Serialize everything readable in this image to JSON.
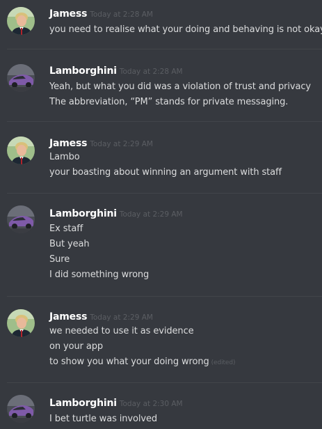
{
  "groups": [
    {
      "username": "Jamess",
      "avatar": "jamess-avatar",
      "timestamp": "Today at 2:28 AM",
      "lines": [
        {
          "text": "you need to realise what your doing and behaving is not okay."
        }
      ]
    },
    {
      "username": "Lamborghini",
      "avatar": "lamborghini-avatar",
      "timestamp": "Today at 2:28 AM",
      "lines": [
        {
          "text": "Yeah, but what you did was a violation of trust and privacy"
        },
        {
          "text": "The abbreviation, “PM” stands for private messaging."
        }
      ]
    },
    {
      "username": "Jamess",
      "avatar": "jamess-avatar",
      "timestamp": "Today at 2:29 AM",
      "lines": [
        {
          "text": "Lambo"
        },
        {
          "text": "your boasting about winning an argument with staff"
        }
      ]
    },
    {
      "username": "Lamborghini",
      "avatar": "lamborghini-avatar",
      "timestamp": "Today at 2:29 AM",
      "lines": [
        {
          "text": "Ex staff"
        },
        {
          "text": "But yeah"
        },
        {
          "text": "Sure"
        },
        {
          "text": "I did something wrong"
        }
      ]
    },
    {
      "username": "Jamess",
      "avatar": "jamess-avatar",
      "timestamp": "Today at 2:29 AM",
      "lines": [
        {
          "text": "we needed to use it as evidence"
        },
        {
          "text": "on your app"
        },
        {
          "text": "to show you what your doing wrong",
          "edited": "(edited)"
        }
      ]
    },
    {
      "username": "Lamborghini",
      "avatar": "lamborghini-avatar",
      "timestamp": "Today at 2:30 AM",
      "lines": [
        {
          "text": "I bet turtle was involved"
        }
      ]
    }
  ],
  "colors": {
    "background": "#36393f",
    "username": "#ffffff",
    "message_text": "#dcddde",
    "timestamp": "#5b5e63",
    "divider": "#42454a"
  }
}
